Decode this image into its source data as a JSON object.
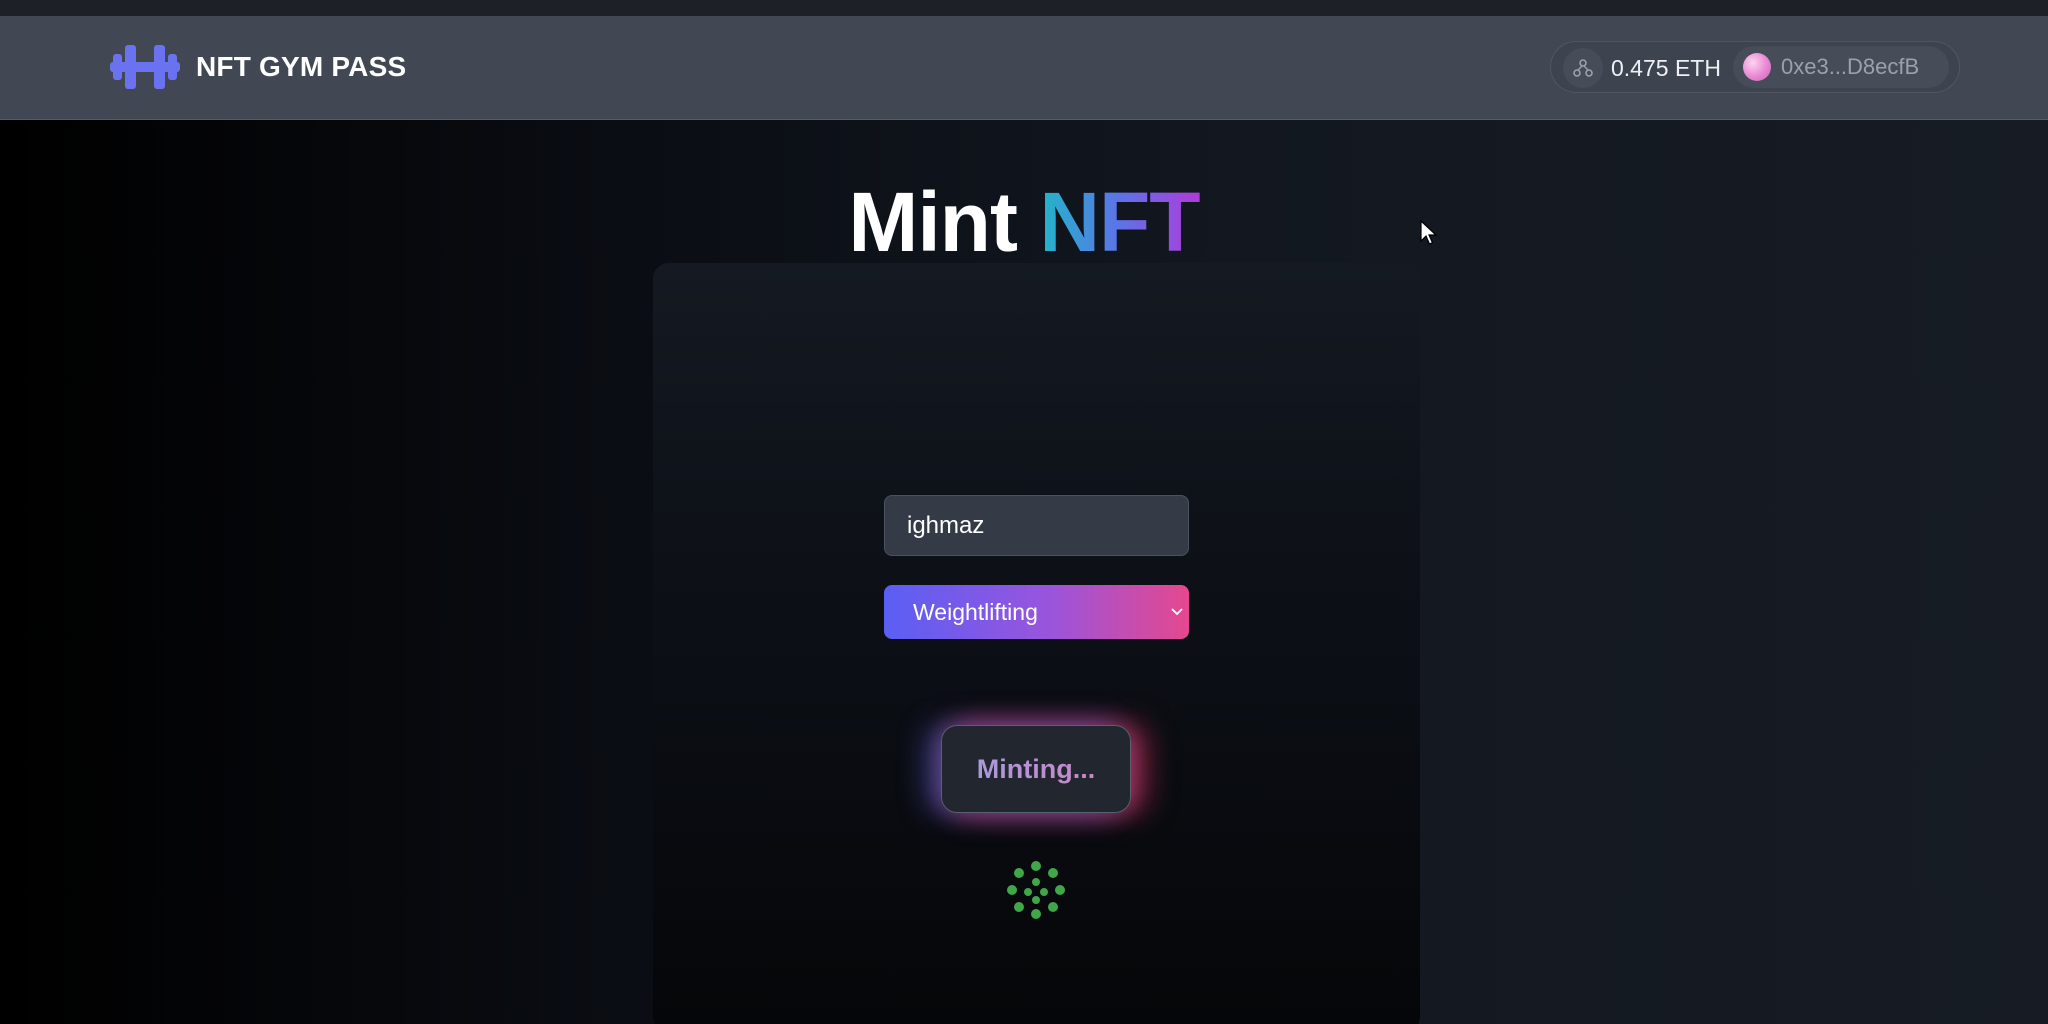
{
  "header": {
    "brand_name": "NFT GYM PASS",
    "wallet": {
      "balance": "0.475 ETH",
      "address": "0xe3...D8ecfB"
    }
  },
  "main": {
    "title_plain": "Mint",
    "title_accent": "NFT",
    "form": {
      "name_value": "ighmaz",
      "category_selected": "Weightlifting",
      "mint_button_label": "Minting..."
    }
  },
  "icons": {
    "logo": "dumbbell-icon",
    "network": "network-icon",
    "avatar": "avatar",
    "select_arrow": "chevron-down-icon",
    "loading": "loading-spinner-icon",
    "cursor": "mouse-cursor-icon"
  },
  "colors": {
    "navbar": "#414854",
    "brand_accent": "#6b72f0",
    "title_gradient": [
      "#21b6c9",
      "#5d73e8",
      "#b03bd9"
    ],
    "select_gradient": [
      "#5a5ff4",
      "#e5488e"
    ],
    "spinner": "#3fa64a"
  }
}
